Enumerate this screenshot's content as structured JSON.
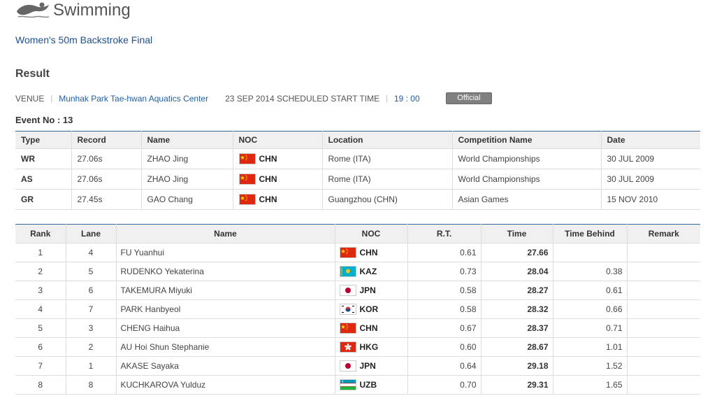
{
  "header": {
    "sport_title": "Swimming",
    "icon": "swimmer-icon"
  },
  "event_title": "Women's 50m Backstroke Final",
  "result_heading": "Result",
  "venue": {
    "label": "VENUE",
    "name": "Munhak Park Tae-hwan Aquatics Center",
    "date_text": "23 SEP 2014 SCHEDULED START TIME",
    "time": "19 : 00"
  },
  "status_badge": "Official",
  "event_no": "Event No : 13",
  "records": {
    "headers": [
      "Type",
      "Record",
      "Name",
      "NOC",
      "Location",
      "Competition Name",
      "Date"
    ],
    "rows": [
      {
        "type": "WR",
        "record": "27.06s",
        "name": "ZHAO Jing",
        "noc": "CHN",
        "location": "Rome (ITA)",
        "competition": "World Championships",
        "date": "30 JUL 2009"
      },
      {
        "type": "AS",
        "record": "27.06s",
        "name": "ZHAO Jing",
        "noc": "CHN",
        "location": "Rome (ITA)",
        "competition": "World Championships",
        "date": "30 JUL 2009"
      },
      {
        "type": "GR",
        "record": "27.45s",
        "name": "GAO Chang",
        "noc": "CHN",
        "location": "Guangzhou (CHN)",
        "competition": "Asian Games",
        "date": "15 NOV 2010"
      }
    ]
  },
  "results": {
    "headers": [
      "Rank",
      "Lane",
      "Name",
      "NOC",
      "R.T.",
      "Time",
      "Time Behind",
      "Remark"
    ],
    "rows": [
      {
        "rank": "1",
        "lane": "4",
        "name": "FU Yuanhui",
        "noc": "CHN",
        "rt": "0.61",
        "time": "27.66",
        "behind": "",
        "remark": ""
      },
      {
        "rank": "2",
        "lane": "5",
        "name": "RUDENKO Yekaterina",
        "noc": "KAZ",
        "rt": "0.73",
        "time": "28.04",
        "behind": "0.38",
        "remark": ""
      },
      {
        "rank": "3",
        "lane": "6",
        "name": "TAKEMURA Miyuki",
        "noc": "JPN",
        "rt": "0.58",
        "time": "28.27",
        "behind": "0.61",
        "remark": ""
      },
      {
        "rank": "4",
        "lane": "7",
        "name": "PARK Hanbyeol",
        "noc": "KOR",
        "rt": "0.58",
        "time": "28.32",
        "behind": "0.66",
        "remark": ""
      },
      {
        "rank": "5",
        "lane": "3",
        "name": "CHENG Haihua",
        "noc": "CHN",
        "rt": "0.67",
        "time": "28.37",
        "behind": "0.71",
        "remark": ""
      },
      {
        "rank": "6",
        "lane": "2",
        "name": "AU Hoi Shun Stephanie",
        "noc": "HKG",
        "rt": "0.60",
        "time": "28.67",
        "behind": "1.01",
        "remark": ""
      },
      {
        "rank": "7",
        "lane": "1",
        "name": "AKASE Sayaka",
        "noc": "JPN",
        "rt": "0.64",
        "time": "29.18",
        "behind": "1.52",
        "remark": ""
      },
      {
        "rank": "8",
        "lane": "8",
        "name": "KUCHKAROVA Yulduz",
        "noc": "UZB",
        "rt": "0.70",
        "time": "29.31",
        "behind": "1.65",
        "remark": ""
      }
    ]
  },
  "colors": {
    "link_blue": "#1f4e8c",
    "table_top_border": "#336699",
    "header_bg": "#f0f0f0",
    "badge_bg": "#808080"
  }
}
